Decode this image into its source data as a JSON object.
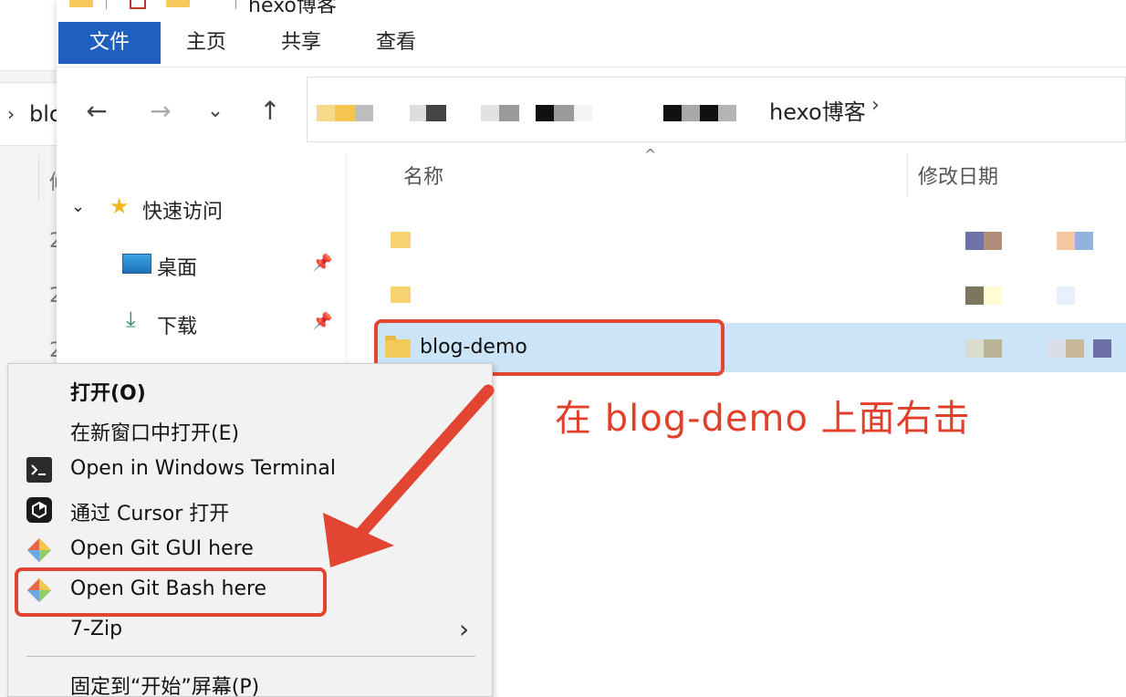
{
  "background_window": {
    "address_text": "blc",
    "column_char": "修",
    "row_chars": [
      "2",
      "2",
      "2"
    ]
  },
  "window": {
    "title": "hexo博客"
  },
  "ribbon": {
    "tabs": [
      {
        "label": "文件",
        "active": true
      },
      {
        "label": "主页",
        "active": false
      },
      {
        "label": "共享",
        "active": false
      },
      {
        "label": "查看",
        "active": false
      }
    ]
  },
  "navigation": {
    "back_icon": "arrow-left-icon",
    "forward_icon": "arrow-right-icon",
    "recent_icon": "chevron-down-icon",
    "up_icon": "arrow-up-icon",
    "breadcrumb_last": "hexo博客",
    "breadcrumb_chevron": "›"
  },
  "nav_pane": {
    "quick_access": "快速访问",
    "items": [
      {
        "label": "桌面",
        "icon": "desktop-icon",
        "pinned": true
      },
      {
        "label": "下载",
        "icon": "download-icon",
        "pinned": true
      }
    ]
  },
  "content": {
    "columns": {
      "name": "名称",
      "modified": "修改日期"
    },
    "rows": [
      {
        "name": "",
        "selected": false
      },
      {
        "name": "",
        "selected": false
      },
      {
        "name": "blog-demo",
        "selected": true
      }
    ]
  },
  "annotation": {
    "text": "在 blog-demo 上面右击",
    "color": "#e23f2b"
  },
  "context_menu": {
    "items": [
      {
        "label": "打开(O)",
        "bold": true,
        "icon": ""
      },
      {
        "label": "在新窗口中打开(E)",
        "bold": false,
        "icon": ""
      },
      {
        "label": "Open in Windows Terminal",
        "bold": false,
        "icon": "terminal-icon"
      },
      {
        "label": "通过 Cursor 打开",
        "bold": false,
        "icon": "cursor-app-icon"
      },
      {
        "label": "Open Git GUI here",
        "bold": false,
        "icon": "git-icon"
      },
      {
        "label": "Open Git Bash here",
        "bold": false,
        "icon": "git-icon"
      },
      {
        "label": "7-Zip",
        "bold": false,
        "icon": "",
        "submenu": true
      },
      {
        "label": "固定到“开始”屏幕(P)",
        "bold": false,
        "icon": ""
      }
    ]
  },
  "colors": {
    "accent": "#1f5fbf",
    "selection": "#cce4f7",
    "highlight": "#e24632"
  }
}
